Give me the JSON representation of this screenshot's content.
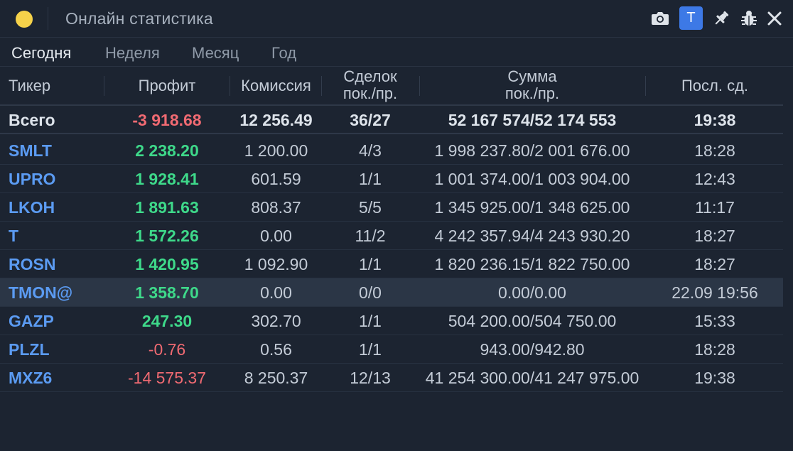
{
  "window": {
    "title": "Онлайн статистика",
    "badge": "T"
  },
  "tabs": [
    "Сегодня",
    "Неделя",
    "Месяц",
    "Год"
  ],
  "columns": {
    "ticker": "Тикер",
    "profit": "Профит",
    "commission": "Комиссия",
    "deals_1": "Сделок",
    "deals_2": "пок./пр.",
    "sum_1": "Сумма",
    "sum_2": "пок./пр.",
    "last": "Посл. сд."
  },
  "total": {
    "ticker": "Всего",
    "profit": "-3 918.68",
    "commission": "12 256.49",
    "deals": "36/27",
    "sum": "52 167 574/52 174 553",
    "last": "19:38"
  },
  "rows": [
    {
      "ticker": "SMLT",
      "profit": "2 238.20",
      "commission": "1 200.00",
      "deals": "4/3",
      "sum": "1 998 237.80/2 001 676.00",
      "last": "18:28"
    },
    {
      "ticker": "UPRO",
      "profit": "1 928.41",
      "commission": "601.59",
      "deals": "1/1",
      "sum": "1 001 374.00/1 003 904.00",
      "last": "12:43"
    },
    {
      "ticker": "LKOH",
      "profit": "1 891.63",
      "commission": "808.37",
      "deals": "5/5",
      "sum": "1 345 925.00/1 348 625.00",
      "last": "11:17"
    },
    {
      "ticker": "T",
      "profit": "1 572.26",
      "commission": "0.00",
      "deals": "11/2",
      "sum": "4 242 357.94/4 243 930.20",
      "last": "18:27"
    },
    {
      "ticker": "ROSN",
      "profit": "1 420.95",
      "commission": "1 092.90",
      "deals": "1/1",
      "sum": "1 820 236.15/1 822 750.00",
      "last": "18:27"
    },
    {
      "ticker": "TMON@",
      "profit": "1 358.70",
      "commission": "0.00",
      "deals": "0/0",
      "sum": "0.00/0.00",
      "last": "22.09 19:56"
    },
    {
      "ticker": "GAZP",
      "profit": "247.30",
      "commission": "302.70",
      "deals": "1/1",
      "sum": "504 200.00/504 750.00",
      "last": "15:33"
    },
    {
      "ticker": "PLZL",
      "profit": "-0.76",
      "commission": "0.56",
      "deals": "1/1",
      "sum": "943.00/942.80",
      "last": "18:28"
    },
    {
      "ticker": "MXZ6",
      "profit": "-14 575.37",
      "commission": "8 250.37",
      "deals": "12/13",
      "sum": "41 254 300.00/41 247 975.00",
      "last": "19:38"
    }
  ],
  "colors": {
    "background": "#1c2431",
    "positive": "#3ed98a",
    "negative": "#f06a72",
    "ticker": "#5b9bf2",
    "badge": "#3d79e6",
    "indicator": "#f5d24a"
  }
}
